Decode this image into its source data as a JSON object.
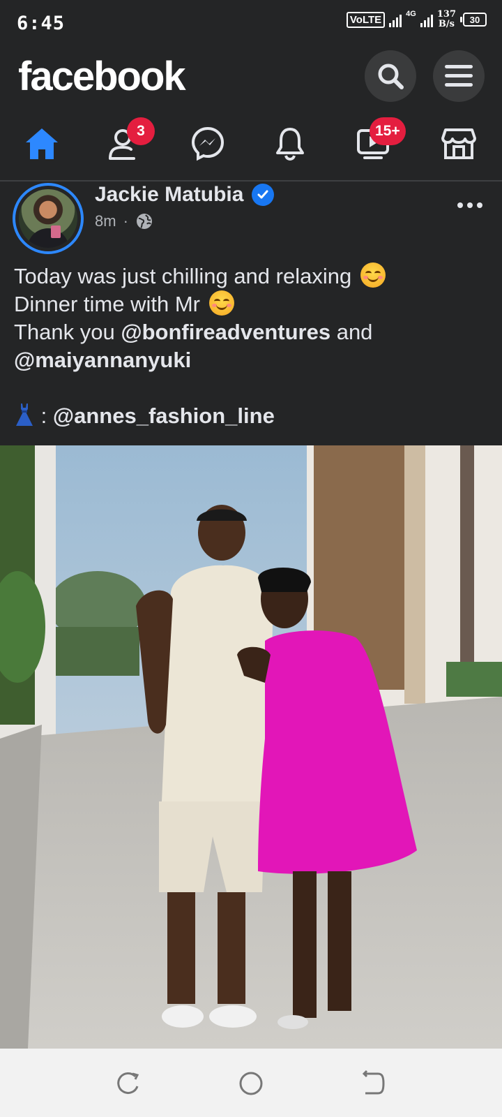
{
  "status_bar": {
    "time": "6:45",
    "volte": "VoLTE",
    "network": "4G",
    "speed_value": "137",
    "speed_unit": "B/s",
    "battery": "30"
  },
  "header": {
    "logo": "facebook",
    "search_icon": "search-icon",
    "menu_icon": "menu-icon"
  },
  "nav": {
    "active": "home",
    "items": [
      {
        "name": "home",
        "icon": "home-icon",
        "badge": ""
      },
      {
        "name": "friends",
        "icon": "friends-icon",
        "badge": "3"
      },
      {
        "name": "messenger",
        "icon": "messenger-icon",
        "badge": ""
      },
      {
        "name": "notifications",
        "icon": "bell-icon",
        "badge": ""
      },
      {
        "name": "watch",
        "icon": "video-icon",
        "badge": "15+"
      },
      {
        "name": "marketplace",
        "icon": "marketplace-icon",
        "badge": ""
      }
    ]
  },
  "post": {
    "author": "Jackie Matubia",
    "time": "8m",
    "separator": "·",
    "privacy_icon": "globe-icon",
    "line1": "Today was just chilling and relaxing",
    "line2": "Dinner time with Mr",
    "line3_prefix": "Thank you",
    "mention1": "@bonfireadventures",
    "line3_mid": "and",
    "mention2": "@maiyannanyuki",
    "dress_prefix": ":",
    "mention3": "@annes_fashion_line"
  },
  "colors": {
    "background": "#242526",
    "accent": "#1877f2",
    "badge": "#e41e3f",
    "text": "#e4e6eb",
    "muted": "#b0b3b8"
  }
}
